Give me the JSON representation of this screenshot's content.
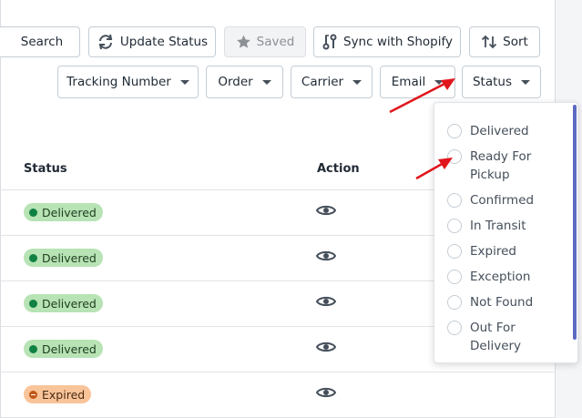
{
  "toolbar": {
    "search_label": "Search",
    "update_status_label": "Update Status",
    "saved_label": "Saved",
    "sync_label": "Sync with Shopify",
    "sort_label": "Sort"
  },
  "filters": {
    "tracking_number": "Tracking Number",
    "order": "Order",
    "carrier": "Carrier",
    "email": "Email",
    "status": "Status"
  },
  "table": {
    "status_header": "Status",
    "action_header": "Action",
    "rows": [
      {
        "status": "Delivered",
        "action_icon": "eye-icon"
      },
      {
        "status": "Delivered",
        "action_icon": "eye-icon"
      },
      {
        "status": "Delivered",
        "action_icon": "eye-icon"
      },
      {
        "status": "Delivered",
        "action_icon": "eye-icon"
      },
      {
        "status": "Expired",
        "action_icon": "eye-icon"
      }
    ]
  },
  "status_dropdown": {
    "options": [
      "Delivered",
      "Ready For Pickup",
      "Confirmed",
      "In Transit",
      "Expired",
      "Exception",
      "Not Found",
      "Out For Delivery"
    ]
  },
  "colors": {
    "delivered_badge": "#b7e3b5",
    "delivered_dot": "#108043",
    "expired_badge": "#f9c49a",
    "expired_dot": "#c05717",
    "annotation_arrow": "#e0161c",
    "scroll_accent": "#5c6ac4"
  }
}
